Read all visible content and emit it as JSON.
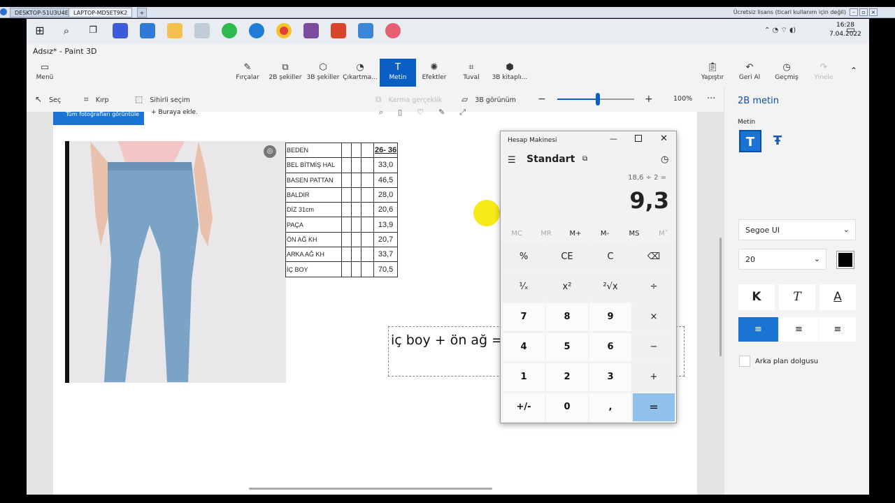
{
  "remote_desktop": {
    "tabs": [
      "DESKTOP-51U3U4E",
      "LAPTOP-MD5ET9K2"
    ],
    "add_tab": "+",
    "license_note": "Ücretsiz lisans (ticari kullanım için değil)"
  },
  "taskbar": {
    "clock_time": "16:28",
    "clock_date": "7.04.2022"
  },
  "app": {
    "title": "Adsız* - Paint 3D",
    "menu_label": "Menü",
    "ribbon": [
      {
        "label": "Fırçalar",
        "icon": "brush-icon"
      },
      {
        "label": "2B şekiller",
        "icon": "2d-shapes-icon"
      },
      {
        "label": "3B şekiller",
        "icon": "3d-shapes-icon"
      },
      {
        "label": "Çıkartma...",
        "icon": "sticker-icon"
      },
      {
        "label": "Metin",
        "icon": "text-icon"
      },
      {
        "label": "Efektler",
        "icon": "effects-icon"
      },
      {
        "label": "Tuval",
        "icon": "canvas-icon"
      },
      {
        "label": "3B kitaplı...",
        "icon": "3d-library-icon"
      }
    ],
    "ribbon_right": [
      {
        "label": "Yapıştır",
        "icon": "paste-icon"
      },
      {
        "label": "Geri Al",
        "icon": "undo-icon"
      },
      {
        "label": "Geçmiş",
        "icon": "history-icon"
      },
      {
        "label": "Yinele",
        "icon": "redo-icon"
      }
    ],
    "tools": {
      "select": "Seç",
      "crop": "Kırp",
      "magic": "Sihirli seçim",
      "mixed_reality": "Karma gerçeklik",
      "view3d": "3B görünüm",
      "zoom": "100%",
      "zoom_fraction": 0.53,
      "more": "···"
    }
  },
  "canvas": {
    "photo_banner": "Tüm fotoğrafları görüntüle",
    "add_here": "Buraya ekle.",
    "text_box": "iç boy + ön ağ =",
    "size_table": {
      "header": "26- 36",
      "rows": [
        {
          "label": "BEDEN",
          "value": ""
        },
        {
          "label": "BEL BİTMİŞ HAL",
          "value": "33,0"
        },
        {
          "label": "BASEN PATTAN",
          "value": "46,5"
        },
        {
          "label": "BALDIR",
          "value": "28,0"
        },
        {
          "label": "DİZ 31cm",
          "value": "20,6"
        },
        {
          "label": "PAÇA",
          "value": "13,9"
        },
        {
          "label": "ÖN AĞ KH",
          "value": "20,7"
        },
        {
          "label": "ARKA AĞ KH",
          "value": "33,7"
        },
        {
          "label": "İÇ BOY",
          "value": "70,5"
        }
      ]
    }
  },
  "panel": {
    "title": "2B metin",
    "section": "Metin",
    "font": "Segoe UI",
    "size": "20",
    "color": "#000000",
    "bold": "K",
    "italic": "T",
    "underline": "A",
    "background_fill": "Arka plan dolgusu"
  },
  "calculator": {
    "title": "Hesap Makinesi",
    "mode": "Standart",
    "expression": "18,6 ÷ 2 =",
    "result": "9,3",
    "memory": [
      "MC",
      "MR",
      "M+",
      "M-",
      "MS",
      "M˅"
    ],
    "keys": [
      [
        "%",
        "CE",
        "C",
        "⌫"
      ],
      [
        "¹⁄ₓ",
        "x²",
        "²√x",
        "÷"
      ],
      [
        "7",
        "8",
        "9",
        "×"
      ],
      [
        "4",
        "5",
        "6",
        "−"
      ],
      [
        "1",
        "2",
        "3",
        "+"
      ],
      [
        "+/-",
        "0",
        ",",
        "="
      ]
    ]
  }
}
